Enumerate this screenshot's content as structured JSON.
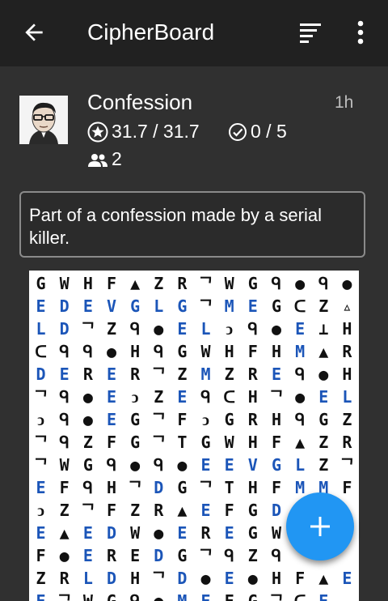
{
  "appbar": {
    "title": "CipherBoard",
    "back_icon": "arrow-back-icon",
    "sort_icon": "sort-icon",
    "more_icon": "more-vert-icon"
  },
  "puzzle": {
    "title": "Confession",
    "time_ago": "1h",
    "score": "31.7 / 31.7",
    "solved": "0 / 5",
    "solvers": "2",
    "description": "Part of a confession made by a serial killer."
  },
  "cipher_rows": [
    [
      "G",
      "W",
      "H",
      "F",
      "▲",
      "Z",
      "R",
      "ᄀ",
      "W",
      "G",
      "ᑫ",
      "●",
      "ᑫ",
      "●"
    ],
    [
      "E",
      "D",
      "E",
      "V",
      "G",
      "L",
      "G",
      "ᄀ",
      "M",
      "E",
      "G",
      "ᑕ",
      "Z",
      "▵"
    ],
    [
      "L",
      "D",
      "ᄀ",
      "Z",
      "ᑫ",
      "●",
      "E",
      "L",
      "ↄ",
      "ᑫ",
      "●",
      "E",
      "⊥",
      "H"
    ],
    [
      "ᑕ",
      "ᑫ",
      "ᑫ",
      "●",
      "H",
      "ᑫ",
      "G",
      "W",
      "H",
      "F",
      "H",
      "M",
      "▲",
      "R"
    ],
    [
      "D",
      "E",
      "R",
      "E",
      "R",
      "ᄀ",
      "Z",
      "M",
      "Z",
      "R",
      "E",
      "ᑫ",
      "●",
      "H"
    ],
    [
      "ᄀ",
      "ᑫ",
      "●",
      "E",
      "ↄ",
      "Z",
      "E",
      "ᑫ",
      "ᑕ",
      "H",
      "ᄀ",
      "●",
      "E",
      "L"
    ],
    [
      "ↄ",
      "ᑫ",
      "●",
      "E",
      "G",
      "ᄀ",
      "F",
      "ↄ",
      "G",
      "R",
      "H",
      "ᑫ",
      "G",
      "Z"
    ],
    [
      "ᄀ",
      "ᑫ",
      "Z",
      "F",
      "G",
      "ᄀ",
      "T",
      "G",
      "W",
      "H",
      "F",
      "▲",
      "Z",
      "R"
    ],
    [
      "ᄀ",
      "W",
      "G",
      "ᑫ",
      "●",
      "ᑫ",
      "●",
      "E",
      "E",
      "V",
      "G",
      "L",
      "Z",
      "ᄀ"
    ],
    [
      "E",
      "F",
      "ᑫ",
      "H",
      "ᄀ",
      "D",
      "G",
      "ᄀ",
      "T",
      "H",
      "F",
      "M",
      "M",
      "F"
    ],
    [
      "ↄ",
      "Z",
      "ᄀ",
      "F",
      "Z",
      "R",
      "▲",
      "E",
      "F",
      "G",
      "D",
      "E",
      "",
      ""
    ],
    [
      "E",
      "▲",
      "E",
      "D",
      "W",
      "●",
      "E",
      "R",
      "E",
      "G",
      "W",
      "",
      "",
      ""
    ],
    [
      "F",
      "●",
      "E",
      "R",
      "E",
      "D",
      "G",
      "ᄀ",
      "ᑫ",
      "Z",
      "ᑫ",
      "",
      "",
      ""
    ],
    [
      "Z",
      "R",
      "L",
      "D",
      "H",
      "ᄀ",
      "D",
      "●",
      "E",
      "●",
      "H",
      "F",
      "▲",
      "E"
    ],
    [
      "E",
      "ᄀ",
      "W",
      "G",
      "ᑫ",
      "●",
      "M",
      "E",
      "F",
      "G",
      "ᄀ",
      "ᑕ",
      "E",
      ""
    ]
  ],
  "cipher_blue": [
    [],
    [
      0,
      1,
      2,
      3,
      4,
      5,
      6,
      8,
      9
    ],
    [
      0,
      1,
      6,
      7,
      11
    ],
    [
      11
    ],
    [
      0,
      1,
      3,
      7,
      10
    ],
    [
      3,
      6,
      12,
      13
    ],
    [
      3
    ],
    [],
    [
      7,
      8,
      9,
      10,
      11
    ],
    [
      0,
      5,
      11,
      12
    ],
    [
      7,
      10,
      11
    ],
    [
      0,
      2,
      3,
      6,
      8
    ],
    [
      2,
      5
    ],
    [
      2,
      3,
      6,
      8,
      13
    ],
    [
      0,
      6,
      7,
      12
    ]
  ],
  "fab": {
    "icon": "plus-icon"
  }
}
